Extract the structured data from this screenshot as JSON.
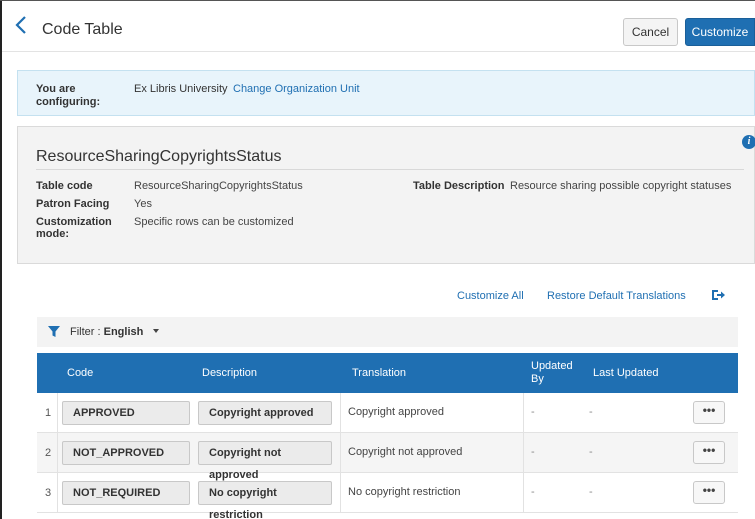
{
  "header": {
    "title": "Code Table",
    "cancel_label": "Cancel",
    "customize_label": "Customize"
  },
  "config": {
    "label": "You are configuring:",
    "org": "Ex Libris University",
    "change_link": "Change Organization Unit"
  },
  "details": {
    "title": "ResourceSharingCopyrightsStatus",
    "fields": [
      {
        "label": "Table code",
        "value": "ResourceSharingCopyrightsStatus"
      },
      {
        "label": "Patron Facing",
        "value": "Yes"
      },
      {
        "label": "Customization mode:",
        "value": "Specific rows can be customized"
      },
      {
        "label": "Table Description",
        "value": "Resource sharing possible copyright statuses"
      }
    ]
  },
  "actions": {
    "customize_all": "Customize All",
    "restore": "Restore Default Translations"
  },
  "filter": {
    "label": "Filter :",
    "value": "English"
  },
  "table": {
    "columns": [
      "Code",
      "Description",
      "Translation",
      "Updated By",
      "Last Updated"
    ],
    "rows": [
      {
        "num": "1",
        "code": "APPROVED",
        "description": "Copyright approved",
        "translation": "Copyright approved",
        "updated_by": "-",
        "last_updated": "-",
        "more": "•••"
      },
      {
        "num": "2",
        "code": "NOT_APPROVED",
        "description": "Copyright not approved",
        "translation": "Copyright not approved",
        "updated_by": "-",
        "last_updated": "-",
        "more": "•••"
      },
      {
        "num": "3",
        "code": "NOT_REQUIRED",
        "description": "No copyright restriction",
        "translation": "No copyright restriction",
        "updated_by": "-",
        "last_updated": "-",
        "more": "•••"
      }
    ]
  },
  "colors": {
    "accent": "#1f6fb2",
    "banner": "#e8f4fb",
    "panel": "#f3f3f3"
  }
}
